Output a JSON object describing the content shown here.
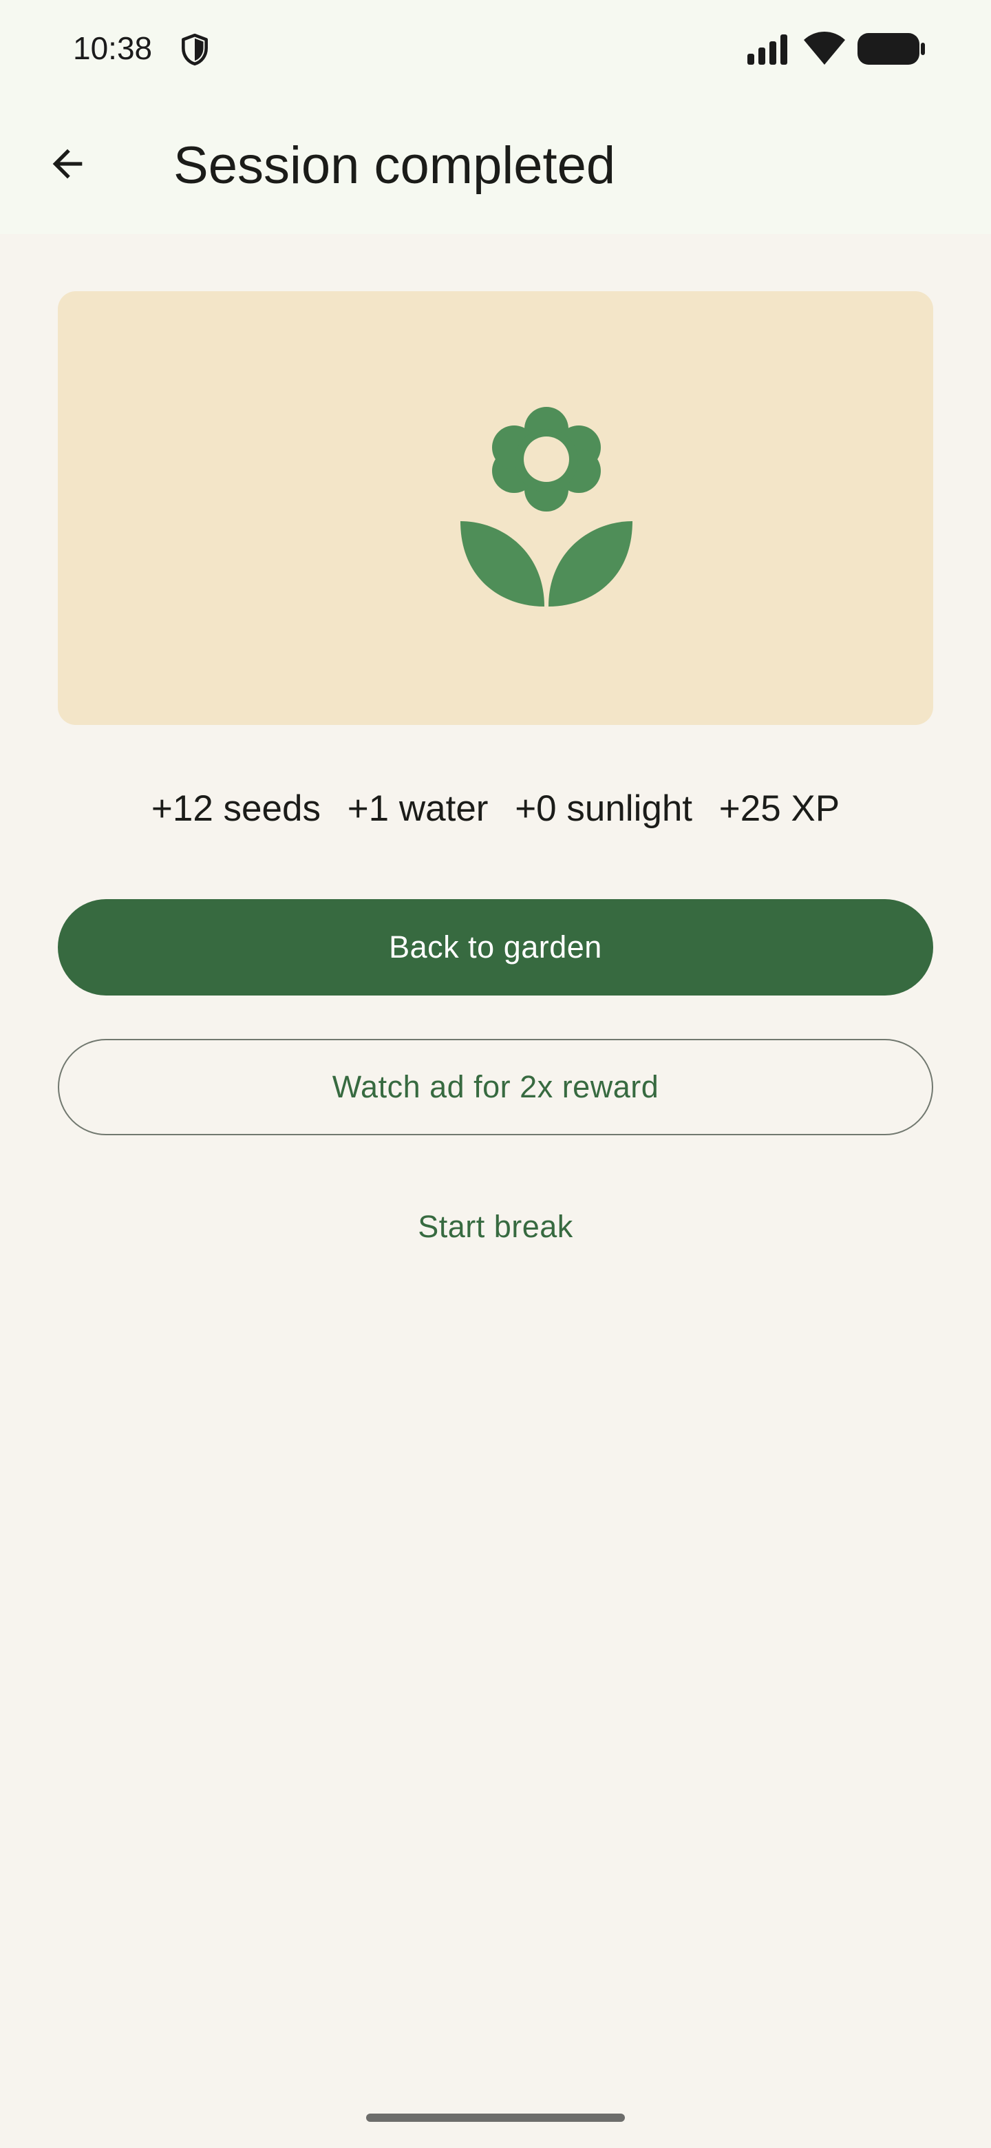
{
  "status_bar": {
    "time": "10:38",
    "icons": [
      "shield-icon",
      "signal-icon",
      "wifi-icon",
      "battery-icon"
    ]
  },
  "app_bar": {
    "back_icon": "arrow-back-icon",
    "title": "Session completed"
  },
  "hero": {
    "icon": "flower-icon",
    "background_color": "#f3e5c8",
    "icon_color": "#4f8e58"
  },
  "rewards": [
    "+12 seeds",
    "+1 water",
    "+0 sunlight",
    "+25 XP"
  ],
  "buttons": {
    "primary": "Back to garden",
    "outlined": "Watch ad for 2x reward",
    "text": "Start break"
  },
  "colors": {
    "primary": "#376a40",
    "background": "#f7f4ee",
    "top_bar": "#f6f9f1"
  }
}
